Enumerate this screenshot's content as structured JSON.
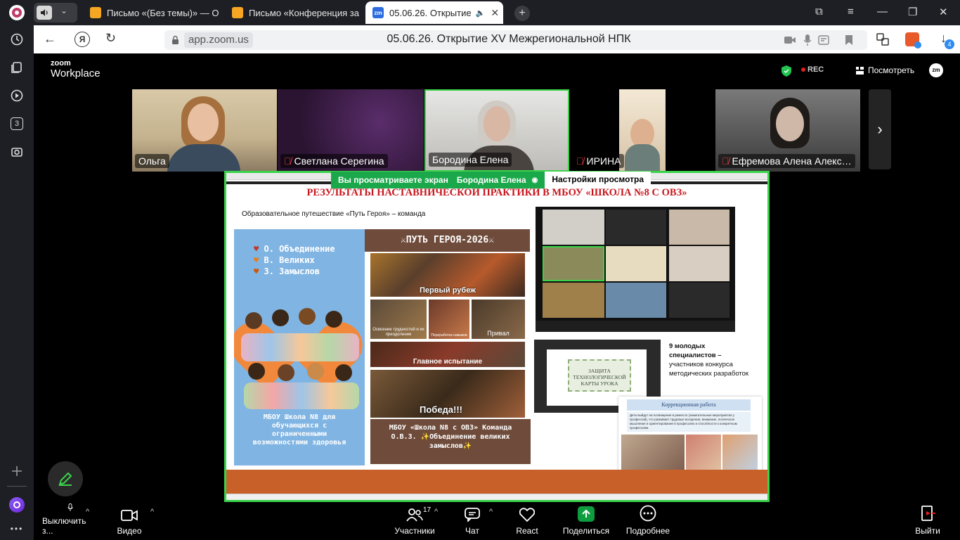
{
  "browser": {
    "tabs": [
      {
        "label": "Письмо «(Без темы)» — О"
      },
      {
        "label": "Письмо «Конференция за"
      },
      {
        "label": "05.06.26. Открытие"
      }
    ],
    "url": "app.zoom.us",
    "page_title": "05.06.26. Открытие XV Межрегиональной НПК",
    "left_badge": "3",
    "downloads_badge": "4"
  },
  "zoom": {
    "brand_line1": "zoom",
    "brand_line2": "Workplace",
    "rec_label": "REC",
    "view_label": "Посмотреть",
    "participants": [
      {
        "name": "Ольга",
        "muted": false
      },
      {
        "name": "Светлана Серегина",
        "muted": true
      },
      {
        "name": "Бородина Елена",
        "muted": false
      },
      {
        "name": "ИРИНА",
        "muted": true
      },
      {
        "name": "Ефремова Алена Алекс…",
        "muted": true
      }
    ],
    "share_banner": {
      "prefix": "Вы просматриваете экран",
      "presenter": "Бородина Елена",
      "settings": "Настройки просмотра"
    },
    "toolbar": {
      "mute": "Выключить з...",
      "video": "Видео",
      "participants": "Участники",
      "participants_count": "17",
      "chat": "Чат",
      "react": "React",
      "share": "Поделиться",
      "more": "Подробнее",
      "leave": "Выйти"
    }
  },
  "slide": {
    "title": "РЕЗУЛЬТАТЫ НАСТАВНИЧЕСКОЙ ПРАКТИКИ В МБОУ «ШКОЛА №8 С ОВЗ»",
    "subtitle": "Образовательное путешествие «Путь Героя» – команда",
    "poster_lines": [
      "О. Объединение",
      "В. Великих",
      "З. Замыслов"
    ],
    "poster_bottom": "МБОУ Школа N8 для обучающихся с ограниченными возможностями здоровья",
    "quest_title": "ПУТЬ ГЕРОЯ-2026",
    "stage1": "Первый рубеж",
    "stage_small1": "Освоение трудностей и их преодоление",
    "stage_small2": "Переработка навыков",
    "stage_small3": "Привал",
    "stage2": "Главное испытание",
    "stage3": "Победа!!!",
    "team_block": "МБОУ «Школа N8 с ОВЗ» Команда О.В.З. ✨Объединение великих замыслов✨",
    "specialists_bold": "9 молодых специалистов –",
    "specialists_rest": "участников конкурса методических разработок",
    "doc_caption": "ЗАЩИТА ТЕХНОЛОГИЧЕСКОЙ КАРТЫ УРОКА",
    "correction_title": "Коррекционная работа",
    "correction_text": "Дети выйдут на посвящение в ремесло (зажигательные мероприятия у профессий), что развивает трудовые воззрения, внимание, логическое мышление и ориентирование в профессиях и способности к конкретным профессиям."
  },
  "colors": {
    "accent_green": "#3ad34a",
    "slide_title_red": "#c8161d",
    "quest_brown": "#6e4b3a",
    "poster_blue": "#7fb4e3",
    "share_green": "#0e9d3e",
    "slide_bottom_orange": "#c8602a"
  }
}
